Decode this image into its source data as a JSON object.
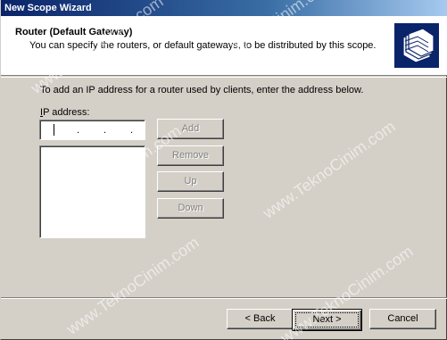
{
  "window": {
    "title": "New Scope Wizard"
  },
  "header": {
    "title": "Router (Default Gateway)",
    "subtitle": "You can specify the routers, or default gateways, to be distributed by this scope."
  },
  "body": {
    "instruction": "To add an IP address for a router used by clients, enter the address below.",
    "ip_label_mnemonic": "I",
    "ip_label_rest": "P address:",
    "ip_value": ""
  },
  "side_buttons": {
    "add_label": "Add",
    "remove_label": "Remove",
    "up_label": "Up",
    "down_label": "Down"
  },
  "nav_buttons": {
    "back_label": "< Back",
    "next_label": "Next >",
    "cancel_label": "Cancel"
  },
  "watermark": "www.TeknoCinim.com",
  "colors": {
    "titlebar_start": "#0a246a",
    "titlebar_end": "#a6caf0",
    "dialog_face": "#d4d0c8",
    "disabled_text": "#808080"
  },
  "icons": {
    "header_icon": "folder-stack-icon"
  }
}
